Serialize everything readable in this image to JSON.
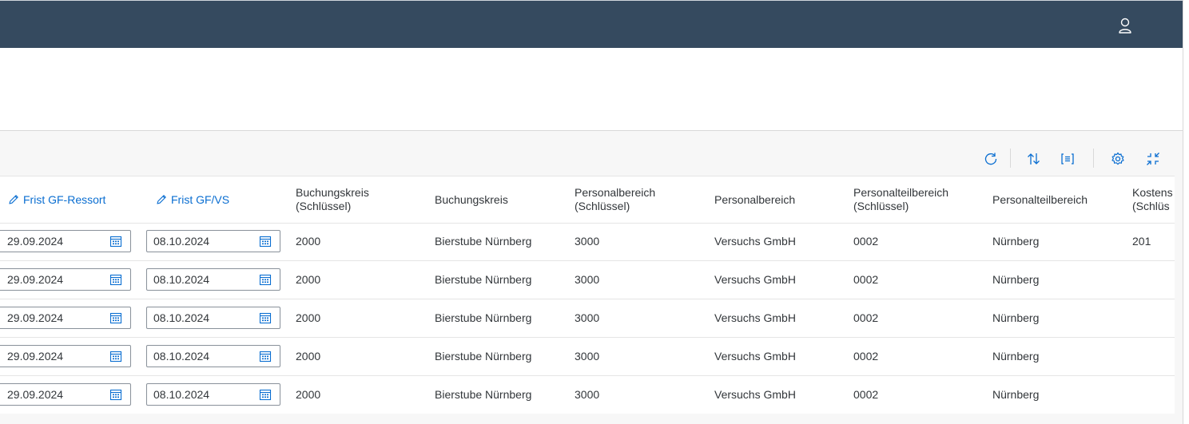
{
  "shell": {
    "user_icon": "person-icon"
  },
  "toolbar": {
    "icons": [
      "refresh-icon",
      "sort-icon",
      "group-icon",
      "settings-icon",
      "exit-fullscreen-icon"
    ]
  },
  "table": {
    "columns": [
      {
        "label": "Frist GF-Ressort",
        "editable": true
      },
      {
        "label": "Frist GF/VS",
        "editable": true
      },
      {
        "label": "Buchungskreis\n(Schlüssel)",
        "editable": false
      },
      {
        "label": "Buchungskreis",
        "editable": false
      },
      {
        "label": "Personalbereich\n(Schlüssel)",
        "editable": false
      },
      {
        "label": "Personalbereich",
        "editable": false
      },
      {
        "label": "Personalteilbereich\n(Schlüssel)",
        "editable": false
      },
      {
        "label": "Personalteilbereich",
        "editable": false
      },
      {
        "label": "Kostens\n(Schlüs",
        "editable": false
      }
    ],
    "rows": [
      {
        "frist_gf_ressort": "29.09.2024",
        "frist_gf_vs": "08.10.2024",
        "bukrs_key": "2000",
        "bukrs": "Bierstube Nürnberg",
        "persbereich_key": "3000",
        "persbereich": "Versuchs GmbH",
        "persteil_key": "0002",
        "persteil": "Nürnberg",
        "kosten_key": "201"
      },
      {
        "frist_gf_ressort": "29.09.2024",
        "frist_gf_vs": "08.10.2024",
        "bukrs_key": "2000",
        "bukrs": "Bierstube Nürnberg",
        "persbereich_key": "3000",
        "persbereich": "Versuchs GmbH",
        "persteil_key": "0002",
        "persteil": "Nürnberg",
        "kosten_key": ""
      },
      {
        "frist_gf_ressort": "29.09.2024",
        "frist_gf_vs": "08.10.2024",
        "bukrs_key": "2000",
        "bukrs": "Bierstube Nürnberg",
        "persbereich_key": "3000",
        "persbereich": "Versuchs GmbH",
        "persteil_key": "0002",
        "persteil": "Nürnberg",
        "kosten_key": ""
      },
      {
        "frist_gf_ressort": "29.09.2024",
        "frist_gf_vs": "08.10.2024",
        "bukrs_key": "2000",
        "bukrs": "Bierstube Nürnberg",
        "persbereich_key": "3000",
        "persbereich": "Versuchs GmbH",
        "persteil_key": "0002",
        "persteil": "Nürnberg",
        "kosten_key": ""
      },
      {
        "frist_gf_ressort": "29.09.2024",
        "frist_gf_vs": "08.10.2024",
        "bukrs_key": "2000",
        "bukrs": "Bierstube Nürnberg",
        "persbereich_key": "3000",
        "persbereich": "Versuchs GmbH",
        "persteil_key": "0002",
        "persteil": "Nürnberg",
        "kosten_key": ""
      }
    ]
  },
  "colors": {
    "shell": "#354a5f",
    "link": "#0a6ed1",
    "text": "#32363a"
  }
}
